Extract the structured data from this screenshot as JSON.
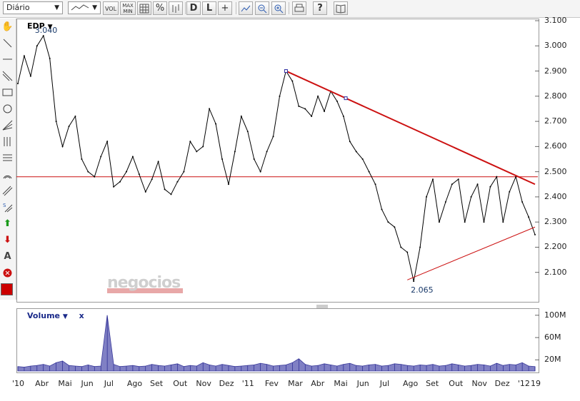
{
  "toolbar": {
    "period_value": "Diário",
    "vol_label": "VOL",
    "maxmin_label": "MAX\nMIN",
    "pct_label": "%",
    "d_label": "D",
    "l_label": "L",
    "help_label": "?"
  },
  "symbol": "EDP",
  "watermark": "negocios",
  "volume_title": "Volume",
  "volume_close": "x",
  "colors": {
    "price_line": "#000000",
    "trend_line": "#cc1111",
    "volume_fill": "#6a6aba",
    "volume_line": "#1a1a8a",
    "accent": "#cc0000"
  },
  "chart_data": [
    {
      "type": "line",
      "series": [
        {
          "values": [
            2.85,
            2.96,
            2.88,
            3.0,
            3.04,
            2.95,
            2.7,
            2.6,
            2.68,
            2.72,
            2.55,
            2.5,
            2.48,
            2.56,
            2.62,
            2.44,
            2.46,
            2.5,
            2.56,
            2.49,
            2.42,
            2.47,
            2.54,
            2.43,
            2.41,
            2.46,
            2.5,
            2.62,
            2.58,
            2.6,
            2.75,
            2.69,
            2.55,
            2.45,
            2.58,
            2.72,
            2.66,
            2.55,
            2.5,
            2.58,
            2.64,
            2.8,
            2.9,
            2.86,
            2.76,
            2.75,
            2.72,
            2.8,
            2.74,
            2.82,
            2.78,
            2.72,
            2.62,
            2.58,
            2.55,
            2.5,
            2.45,
            2.35,
            2.3,
            2.28,
            2.2,
            2.18,
            2.065,
            2.2,
            2.4,
            2.47,
            2.3,
            2.38,
            2.45,
            2.47,
            2.3,
            2.4,
            2.45,
            2.3,
            2.44,
            2.48,
            2.3,
            2.42,
            2.48,
            2.38,
            2.32,
            2.25
          ]
        }
      ],
      "x_ticks": [
        "'10",
        "Abr",
        "Mai",
        "Jun",
        "Jul",
        "Ago",
        "Set",
        "Out",
        "Nov",
        "Dez",
        "'11",
        "Fev",
        "Mar",
        "Abr",
        "Mai",
        "Jun",
        "Jul",
        "Ago",
        "Set",
        "Out",
        "Nov",
        "Dez",
        "'12",
        "19"
      ],
      "y_ticks": [
        "3.100",
        "3.000",
        "2.900",
        "2.800",
        "2.700",
        "2.600",
        "2.500",
        "2.400",
        "2.300",
        "2.200",
        "2.100"
      ],
      "ylim": [
        2.0,
        3.1
      ],
      "annotations": [
        "3.040",
        "2.065"
      ],
      "trend_lines": [
        {
          "from_index": 42,
          "from_value": 2.9,
          "to_index": 81,
          "to_value": 2.45
        },
        {
          "from_index": 61,
          "from_value": 2.07,
          "to_index": 81,
          "to_value": 2.28
        }
      ],
      "horizontal_line": 2.48,
      "grid": false
    },
    {
      "type": "area",
      "series": [
        {
          "name": "Volume",
          "values": [
            8,
            7,
            9,
            10,
            12,
            9,
            15,
            18,
            10,
            9,
            8,
            11,
            8,
            9,
            100,
            12,
            8,
            9,
            10,
            8,
            9,
            12,
            10,
            9,
            11,
            13,
            8,
            10,
            9,
            15,
            11,
            9,
            12,
            10,
            8,
            9,
            10,
            11,
            14,
            12,
            9,
            10,
            11,
            15,
            22,
            12,
            9,
            10,
            13,
            11,
            9,
            12,
            14,
            10,
            9,
            11,
            12,
            9,
            10,
            13,
            12,
            10,
            9,
            11,
            10,
            12,
            9,
            10,
            13,
            11,
            9,
            10,
            12,
            11,
            9,
            14,
            10,
            12,
            11,
            15,
            9,
            8
          ]
        }
      ],
      "y_ticks": [
        "100M",
        "60M",
        "20M"
      ],
      "ylim": [
        0,
        110
      ],
      "grid": false
    }
  ]
}
